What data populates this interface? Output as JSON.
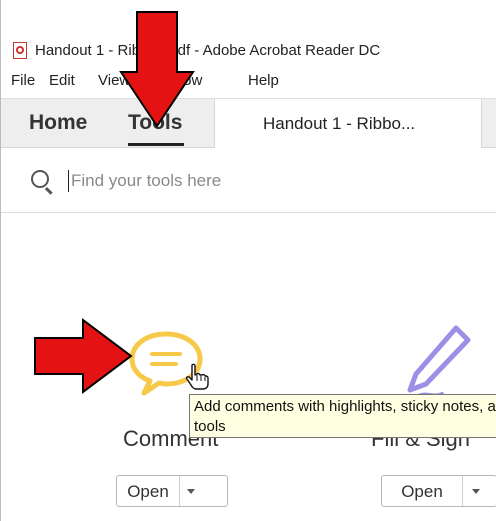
{
  "window": {
    "title": "Handout 1 - Ribbon.pdf - Adobe Acrobat Reader DC"
  },
  "menu": [
    "File",
    "Edit",
    "View",
    "Window",
    "Help"
  ],
  "tabs": {
    "home": "Home",
    "tools": "Tools",
    "document": "Handout 1 - Ribbo..."
  },
  "search": {
    "placeholder": "Find your tools here",
    "value": ""
  },
  "tools": [
    {
      "name": "Comment",
      "button": "Open",
      "icon": "comment-bubble-icon"
    },
    {
      "name": "Fill & Sign",
      "button": "Open",
      "icon": "pen-sign-icon"
    }
  ],
  "tooltip": {
    "line1": "Add comments with highlights, sticky notes, and other markup",
    "line2": "tools"
  },
  "colors": {
    "comment_icon": "#f7c948",
    "pen_icon": "#9b8fe6",
    "arrow": "#e41212",
    "tooltip_bg": "#ffffe1"
  }
}
